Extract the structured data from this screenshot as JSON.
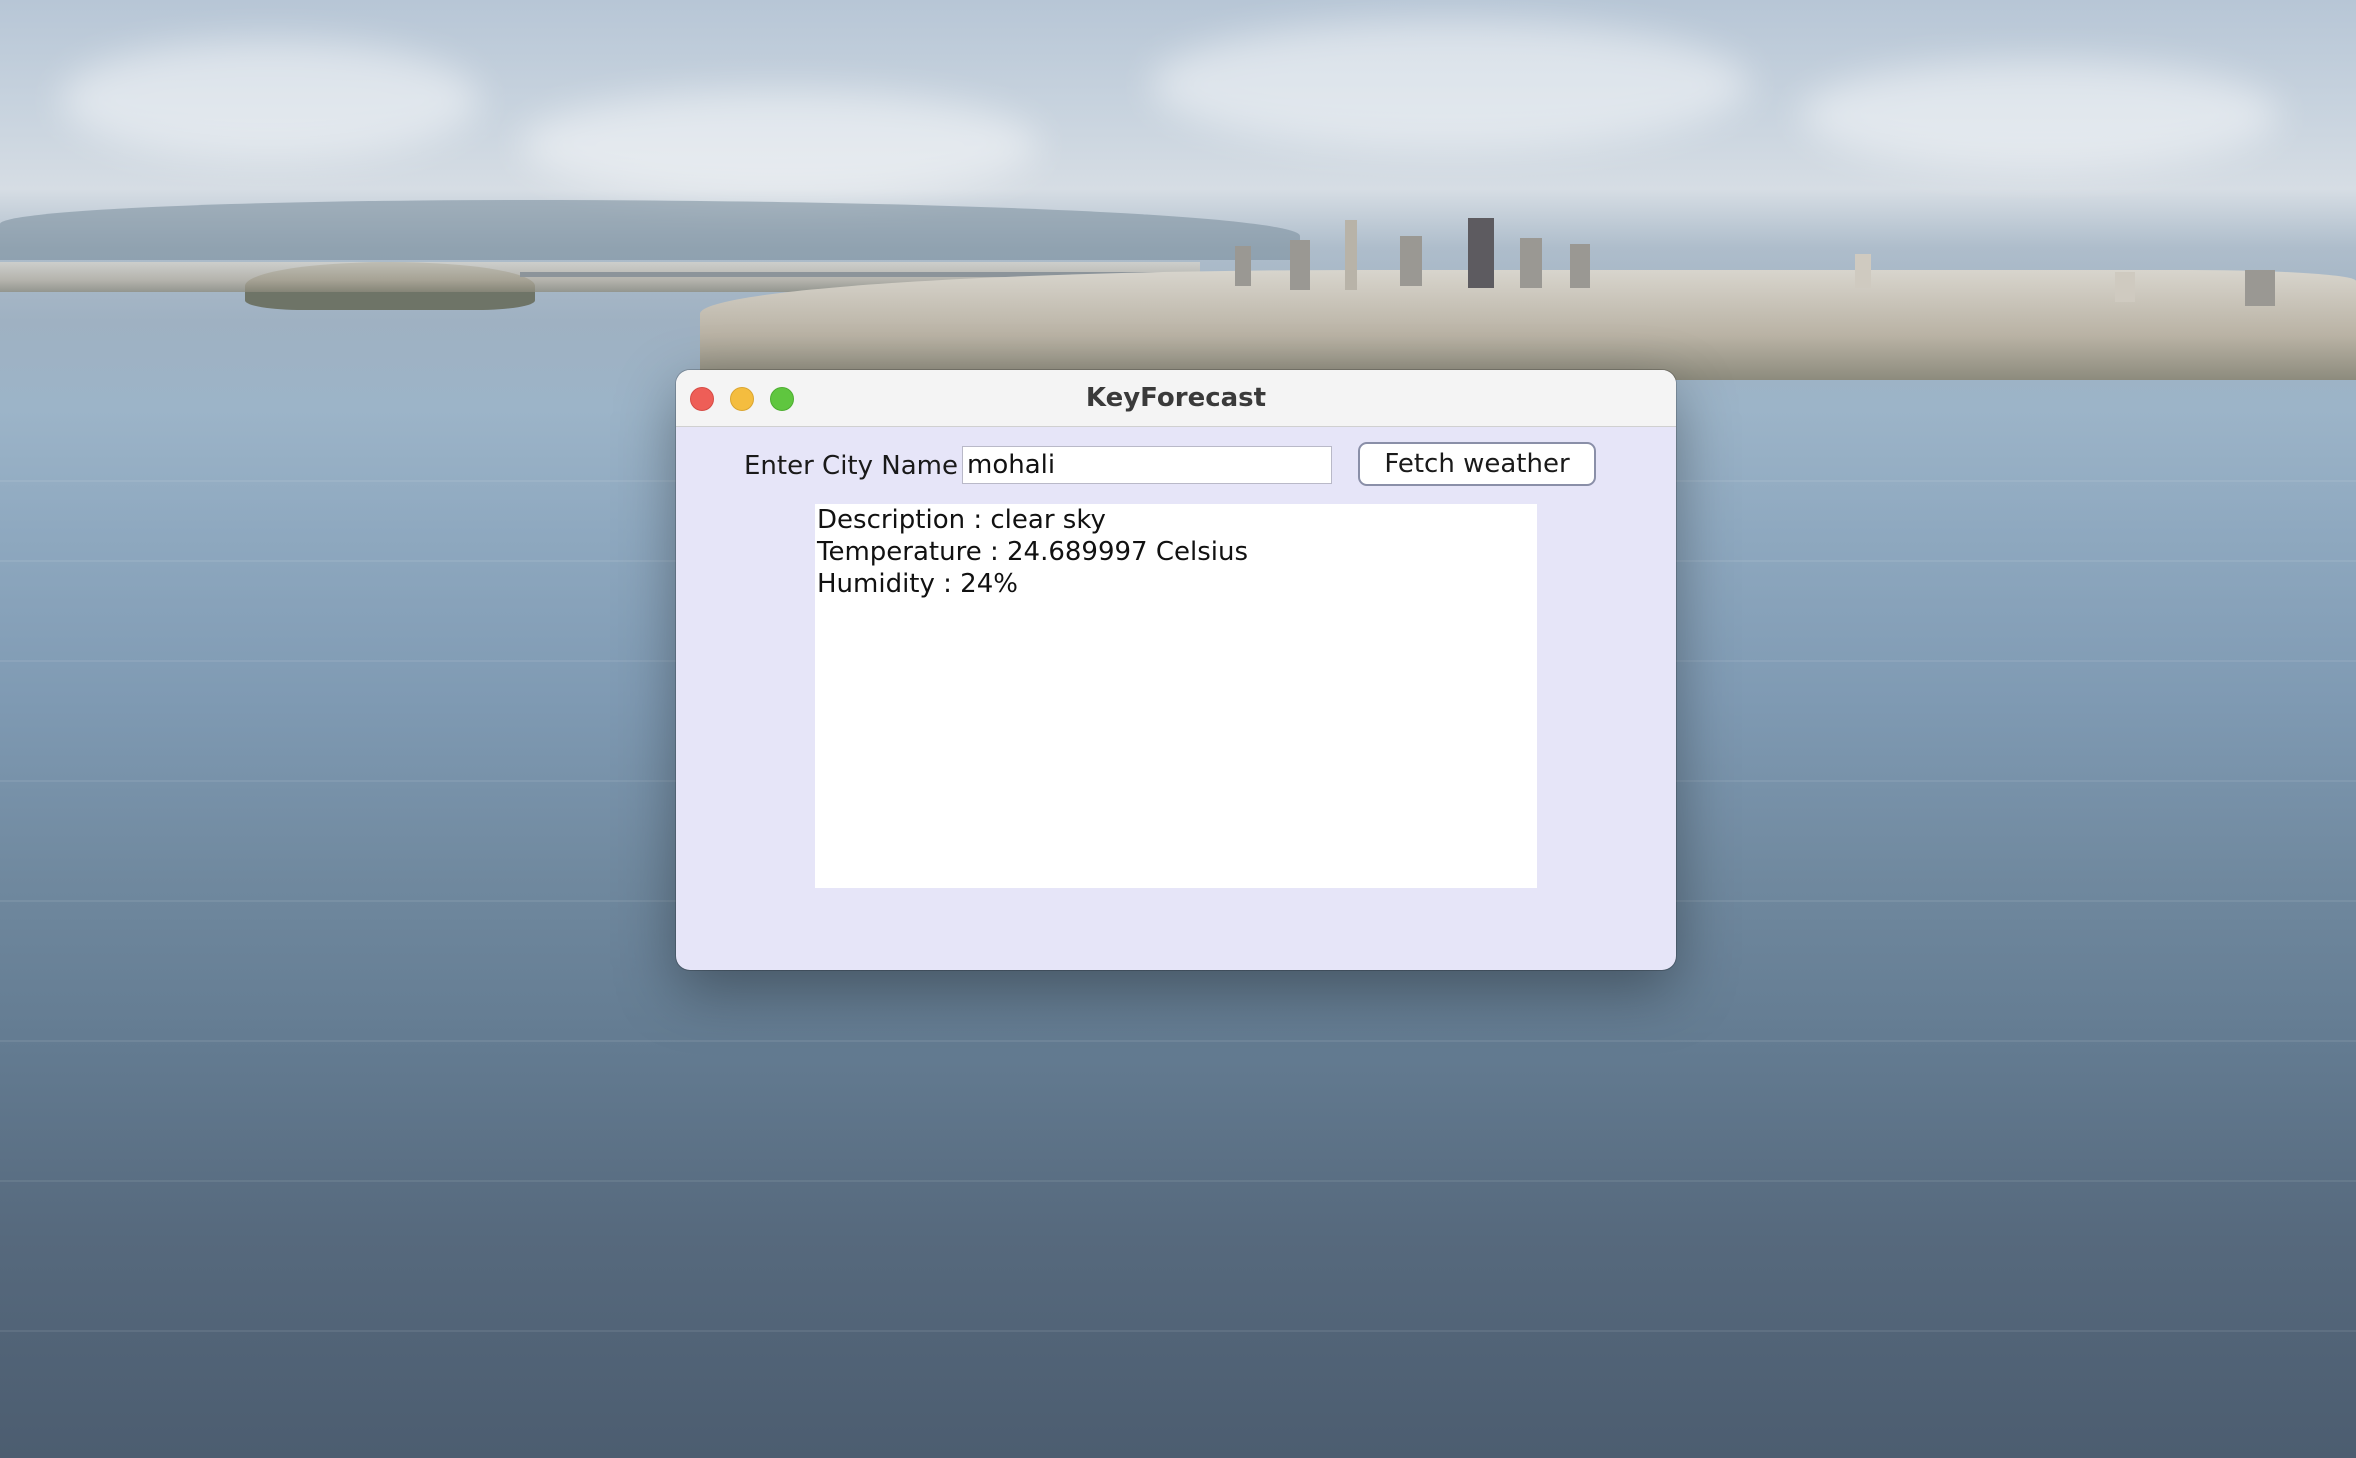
{
  "window": {
    "title": "KeyForecast"
  },
  "form": {
    "city_label": "Enter City Name",
    "city_value": "mohali",
    "fetch_button_label": "Fetch weather"
  },
  "result": {
    "lines": [
      "Description : clear sky",
      "Temperature : 24.689997 Celsius",
      "Humidity : 24%"
    ]
  },
  "colors": {
    "window_background": "#e6e5f8",
    "close": "#ee5e57",
    "minimize": "#f4bd3f",
    "zoom": "#5fc63f"
  }
}
